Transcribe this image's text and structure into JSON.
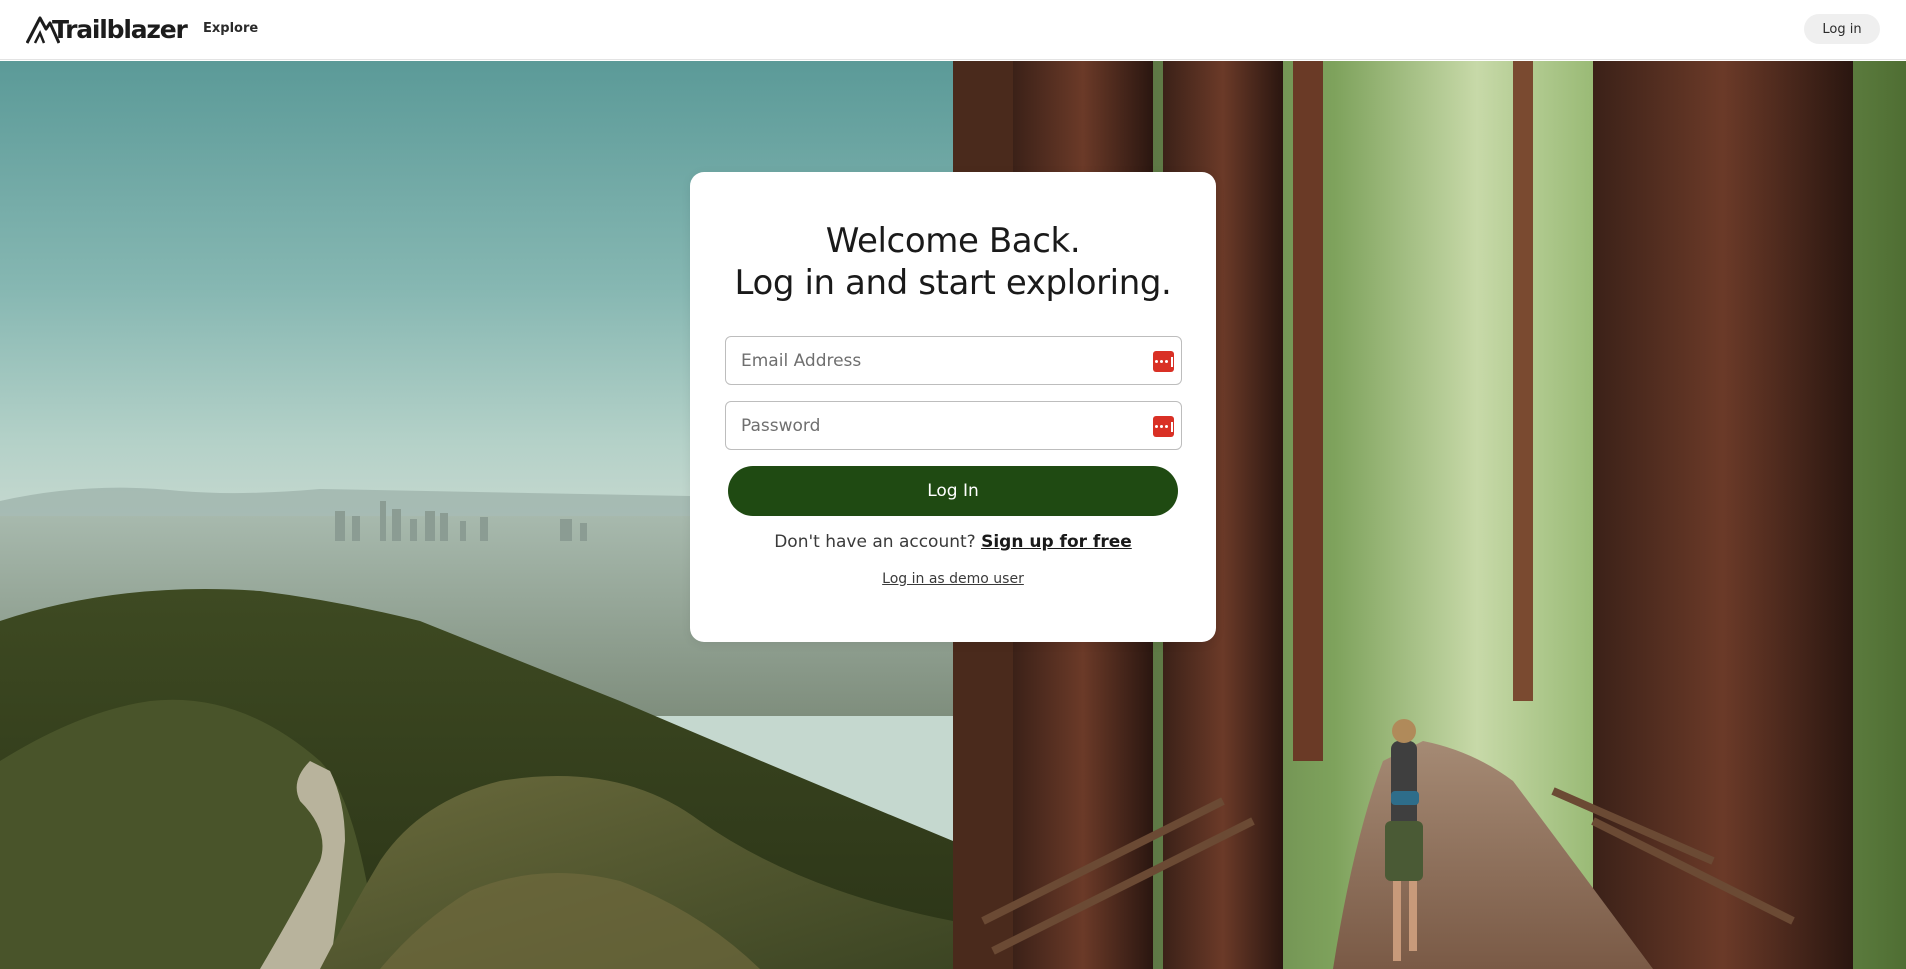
{
  "header": {
    "brand": "Trailblazer",
    "nav_explore": "Explore",
    "login_button": "Log in"
  },
  "login_card": {
    "heading_line1": "Welcome Back.",
    "heading_line2": "Log in and start exploring.",
    "email_placeholder": "Email Address",
    "password_placeholder": "Password",
    "submit_label": "Log In",
    "signup_prompt": "Don't have an account?",
    "signup_link": "Sign up for free",
    "demo_link": "Log in as demo user"
  },
  "images": {
    "left": "city skyline viewed from green hills with a winding trail",
    "right": "hiker walking on a path among giant redwood trees"
  },
  "colors": {
    "primary_button": "#1f4a12",
    "password_manager_icon": "#d93025",
    "header_bg": "#ffffff",
    "pill_bg": "#efefef"
  },
  "icons": {
    "logo": "mountain-logo-icon",
    "field_autofill": "password-manager-icon"
  }
}
